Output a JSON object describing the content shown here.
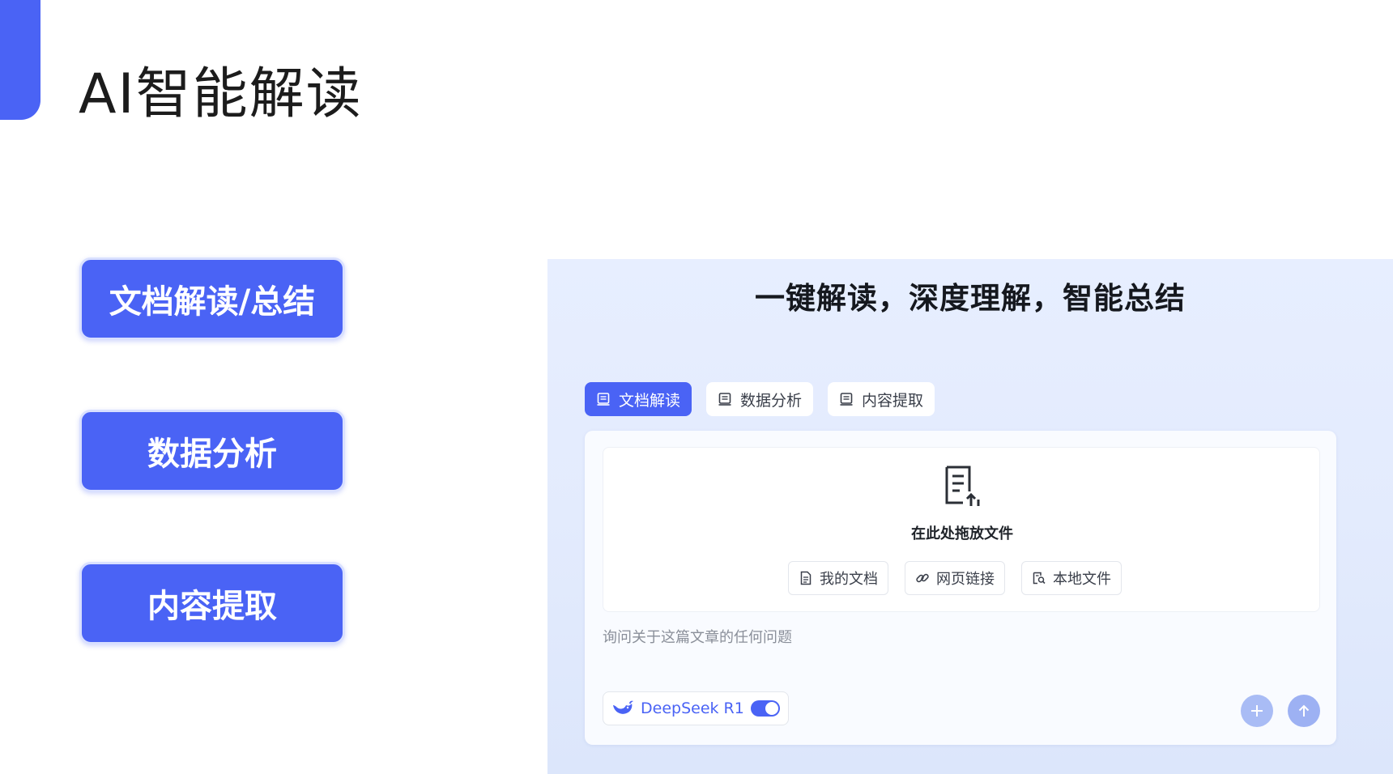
{
  "slide": {
    "title": "AI智能解读",
    "accent_color": "#4a63f5"
  },
  "features": [
    {
      "label": "文档解读/总结"
    },
    {
      "label": "数据分析"
    },
    {
      "label": "内容提取"
    }
  ],
  "app": {
    "heading": "一键解读，深度理解，智能总结",
    "tabs": [
      {
        "label": "文档解读",
        "icon": "document-icon",
        "active": true
      },
      {
        "label": "数据分析",
        "icon": "document-icon",
        "active": false
      },
      {
        "label": "内容提取",
        "icon": "document-icon",
        "active": false
      }
    ],
    "dropzone": {
      "icon": "file-upload-icon",
      "label": "在此处拖放文件",
      "sources": [
        {
          "label": "我的文档",
          "icon": "file-icon"
        },
        {
          "label": "网页链接",
          "icon": "link-icon"
        },
        {
          "label": "本地文件",
          "icon": "local-file-search-icon"
        }
      ]
    },
    "input": {
      "placeholder": "询问关于这篇文章的任何问题",
      "value": ""
    },
    "model": {
      "name": "DeepSeek R1",
      "icon": "deepseek-whale-icon",
      "enabled": true
    },
    "actions": [
      {
        "icon": "plus-icon"
      },
      {
        "icon": "arrow-up-icon"
      }
    ]
  }
}
